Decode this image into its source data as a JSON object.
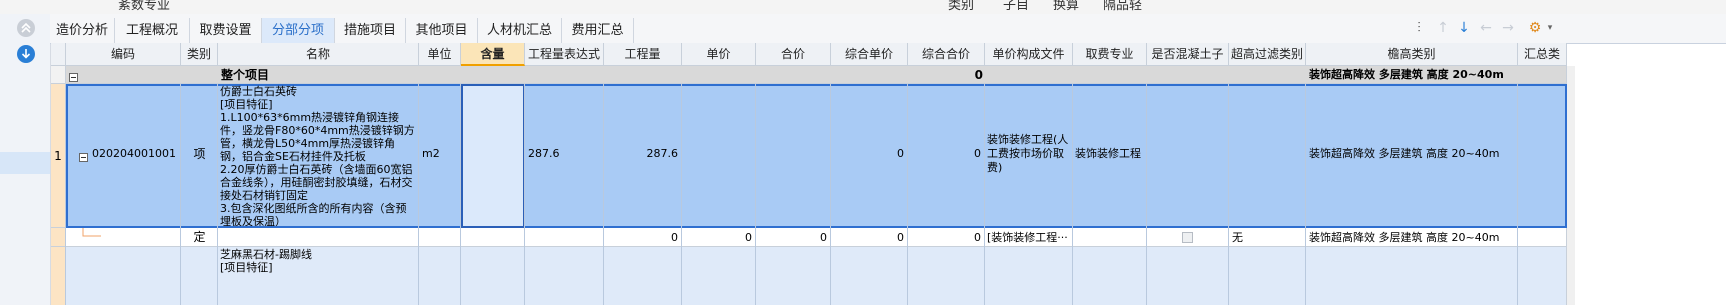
{
  "top_strip": [
    "紊数专业",
    "类别",
    "子目",
    "换算",
    "隔品轻"
  ],
  "tabs": [
    "造价分析",
    "工程概况",
    "取费设置",
    "分部分项",
    "措施项目",
    "其他项目",
    "人材机汇总",
    "费用汇总"
  ],
  "active_tab": "分部分项",
  "columns": [
    "编码",
    "类别",
    "名称",
    "单位",
    "含量",
    "工程量表达式",
    "工程量",
    "单价",
    "合价",
    "综合单价",
    "综合合价",
    "单价构成文件",
    "取费专业",
    "是否混凝土子目",
    "超高过滤类别",
    "檐高类别",
    "汇总类"
  ],
  "group_row": {
    "name": "整个项目",
    "total": "0",
    "eaves": "装饰超高降效 多层建筑 高度 20~40m"
  },
  "item_row": {
    "index": "1",
    "code": "020204001001",
    "type": "项",
    "description": "仿爵士白石英砖\n[项目特征]\n1.L100*63*6mm热浸镀锌角钢连接件，竖龙骨F80*60*4mm热浸镀锌钢方管，横龙骨L50*4mm厚热浸镀锌角钢，铝合金SE石材挂件及托板\n2.20厚仿爵士白石英砖（含墙面60宽铝合金线条），用硅酮密封胶填缝，石材交接处石材销钉固定\n3.包含深化图纸所含的所有内容（含预埋板及保温）",
    "unit": "m2",
    "expression": "287.6",
    "quantity": "287.6",
    "total": "0",
    "comp_total": "0",
    "pricing_file": "装饰装修工程(人工费按市场价取费)",
    "fee_specialty": "装饰装修工程",
    "eaves": "装饰超高降效 多层建筑 高度 20~40m"
  },
  "quota_row": {
    "type": "定",
    "quantity": "0",
    "unit_price": "0",
    "total": "0",
    "comp_unit": "0",
    "comp_total": "0",
    "pricing_file": "[装饰装修工程···",
    "filter": "无",
    "eaves": "装饰超高降效 多层建筑 高度 20~40m"
  },
  "next_row": {
    "description": "芝麻黑石材-踢脚线\n[项目特征]"
  },
  "colors": {
    "selected_row": "#a9cbf5",
    "group_row": "#d9d9d9",
    "accent": "#2a7fd6"
  }
}
